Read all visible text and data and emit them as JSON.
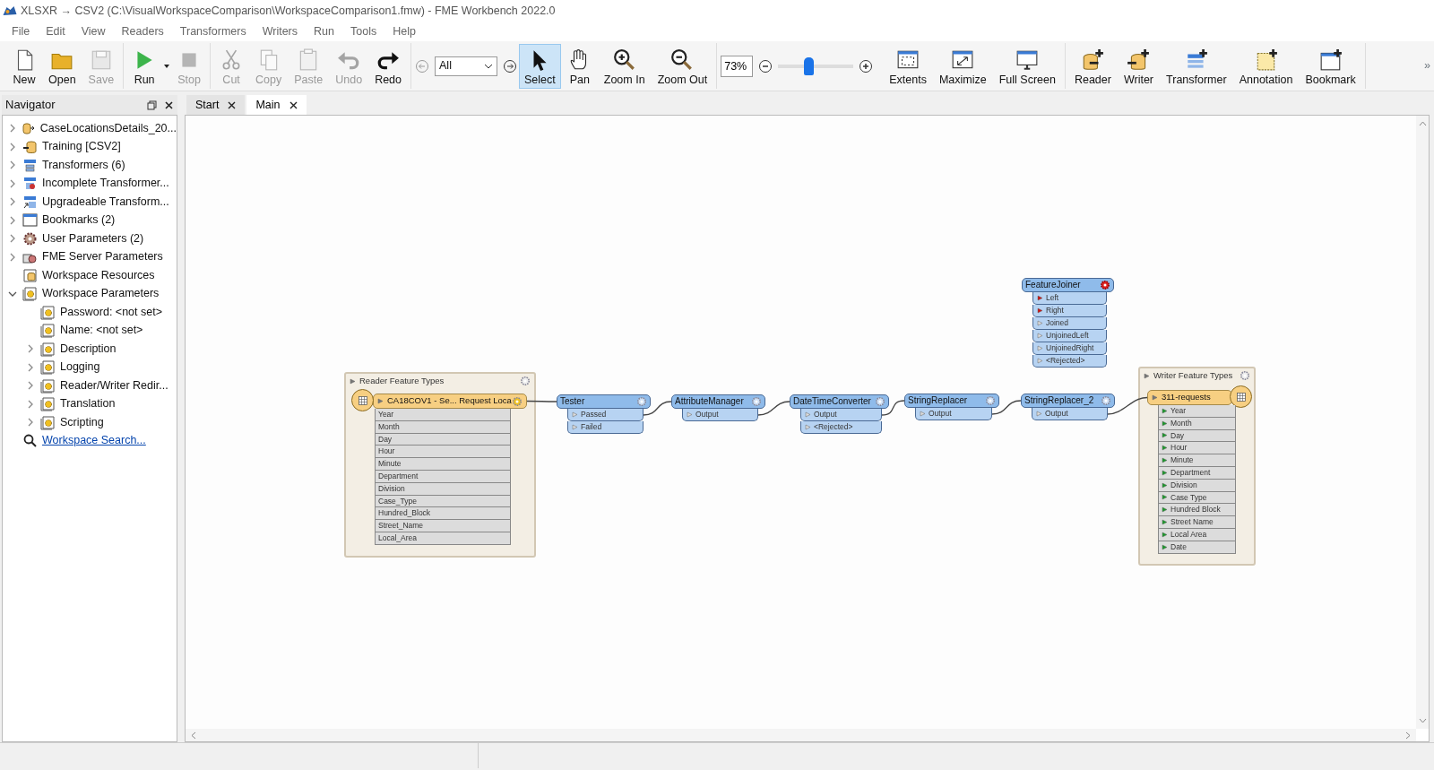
{
  "window": {
    "title": "XLSXR → CSV2 (C:\\VisualWorkspaceComparison\\WorkspaceComparison1.fmw) - FME Workbench 2022.0"
  },
  "menu": [
    "File",
    "Edit",
    "View",
    "Readers",
    "Transformers",
    "Writers",
    "Run",
    "Tools",
    "Help"
  ],
  "toolbar": {
    "groups": [
      [
        {
          "kind": "button",
          "label": "New",
          "disabled": false,
          "selected": false
        },
        {
          "kind": "button",
          "label": "Open",
          "disabled": false,
          "selected": false
        },
        {
          "kind": "button",
          "label": "Save",
          "disabled": true,
          "selected": false
        }
      ],
      [
        {
          "kind": "split",
          "label": "Run",
          "disabled": false,
          "selected": false
        },
        {
          "kind": "button",
          "label": "Stop",
          "disabled": true,
          "selected": false
        }
      ],
      [
        {
          "kind": "button",
          "label": "Cut",
          "disabled": true,
          "selected": false
        },
        {
          "kind": "button",
          "label": "Copy",
          "disabled": true,
          "selected": false
        },
        {
          "kind": "button",
          "label": "Paste",
          "disabled": true,
          "selected": false
        },
        {
          "kind": "button",
          "label": "Undo",
          "disabled": true,
          "selected": false
        },
        {
          "kind": "button",
          "label": "Redo",
          "disabled": false,
          "selected": false
        }
      ],
      [
        {
          "kind": "back"
        },
        {
          "kind": "select",
          "value": "All"
        },
        {
          "kind": "forward"
        },
        {
          "kind": "button",
          "label": "Select",
          "disabled": false,
          "selected": true
        },
        {
          "kind": "button",
          "label": "Pan",
          "disabled": false,
          "selected": false
        },
        {
          "kind": "button",
          "label": "Zoom In",
          "disabled": false,
          "selected": false
        },
        {
          "kind": "button",
          "label": "Zoom Out",
          "disabled": false,
          "selected": false
        }
      ],
      [
        {
          "kind": "zoom_field",
          "value": "73%"
        },
        {
          "kind": "minus"
        },
        {
          "kind": "slider",
          "level": 0.4
        },
        {
          "kind": "plus"
        },
        {
          "kind": "button",
          "label": "Extents",
          "disabled": false,
          "selected": false
        },
        {
          "kind": "button",
          "label": "Maximize",
          "disabled": false,
          "selected": false
        },
        {
          "kind": "button",
          "label": "Full Screen",
          "disabled": false,
          "selected": false
        }
      ],
      [
        {
          "kind": "button",
          "label": "Reader",
          "disabled": false,
          "selected": false
        },
        {
          "kind": "button",
          "label": "Writer",
          "disabled": false,
          "selected": false
        },
        {
          "kind": "button",
          "label": "Transformer",
          "disabled": false,
          "selected": false
        },
        {
          "kind": "button",
          "label": "Annotation",
          "disabled": false,
          "selected": false
        },
        {
          "kind": "button",
          "label": "Bookmark",
          "disabled": false,
          "selected": false
        }
      ]
    ],
    "overflow": "»"
  },
  "navigator": {
    "title": "Navigator",
    "items": [
      {
        "kind": "branch",
        "label": "CaseLocationsDetails_20...",
        "expanded": false
      },
      {
        "kind": "branch",
        "label": "Training [CSV2]",
        "expanded": false
      },
      {
        "kind": "branch",
        "label": "Transformers (6)",
        "expanded": false
      },
      {
        "kind": "branch",
        "label": "Incomplete Transformer...",
        "expanded": false
      },
      {
        "kind": "branch",
        "label": "Upgradeable Transform...",
        "expanded": false
      },
      {
        "kind": "branch",
        "label": "Bookmarks (2)",
        "expanded": false
      },
      {
        "kind": "branch",
        "label": "User Parameters (2)",
        "expanded": false
      },
      {
        "kind": "branch",
        "label": "FME Server Parameters",
        "expanded": false
      },
      {
        "kind": "leaf",
        "label": "Workspace Resources"
      },
      {
        "kind": "branch",
        "label": "Workspace Parameters",
        "expanded": true,
        "children": [
          {
            "kind": "leaf",
            "label": "Password: <not set>"
          },
          {
            "kind": "leaf",
            "label": "Name: <not set>"
          },
          {
            "kind": "branch",
            "label": "Description",
            "expanded": false
          },
          {
            "kind": "branch",
            "label": "Logging",
            "expanded": false
          },
          {
            "kind": "branch",
            "label": "Reader/Writer Redir...",
            "expanded": false
          },
          {
            "kind": "branch",
            "label": "Translation",
            "expanded": false
          },
          {
            "kind": "branch",
            "label": "Scripting",
            "expanded": false
          }
        ]
      },
      {
        "kind": "link",
        "label": "Workspace Search..."
      }
    ]
  },
  "tabs": [
    {
      "label": "Start",
      "selected": false
    },
    {
      "label": "Main",
      "selected": true
    }
  ],
  "canvas": {
    "reader_group": {
      "title": "Reader Feature Types",
      "feature_type": {
        "name": "CA18COV1 - Se... Request Loca",
        "attributes": [
          "Year",
          "Month",
          "Day",
          "Hour",
          "Minute",
          "Department",
          "Division",
          "Case_Type",
          "Hundred_Block",
          "Street_Name",
          "Local_Area"
        ]
      }
    },
    "transformers": [
      {
        "name": "FeatureJoiner",
        "incomplete": true,
        "inputs": [
          "Left",
          "Right"
        ],
        "outputs": [
          "Joined",
          "UnjoinedLeft",
          "UnjoinedRight",
          "<Rejected>"
        ]
      },
      {
        "name": "Tester",
        "incomplete": false,
        "outputs": [
          "Passed",
          "Failed"
        ]
      },
      {
        "name": "AttributeManager",
        "incomplete": false,
        "outputs": [
          "Output"
        ]
      },
      {
        "name": "DateTimeConverter",
        "incomplete": false,
        "outputs": [
          "Output",
          "<Rejected>"
        ]
      },
      {
        "name": "StringReplacer",
        "incomplete": false,
        "outputs": [
          "Output"
        ]
      },
      {
        "name": "StringReplacer_2",
        "incomplete": false,
        "outputs": [
          "Output"
        ]
      }
    ],
    "writer_group": {
      "title": "Writer Feature Types",
      "feature_type": {
        "name": "311-requests",
        "attributes": [
          "Year",
          "Month",
          "Day",
          "Hour",
          "Minute",
          "Department",
          "Division",
          "Case Type",
          "Hundred Block",
          "Street Name",
          "Local Area",
          "Date"
        ]
      }
    }
  }
}
